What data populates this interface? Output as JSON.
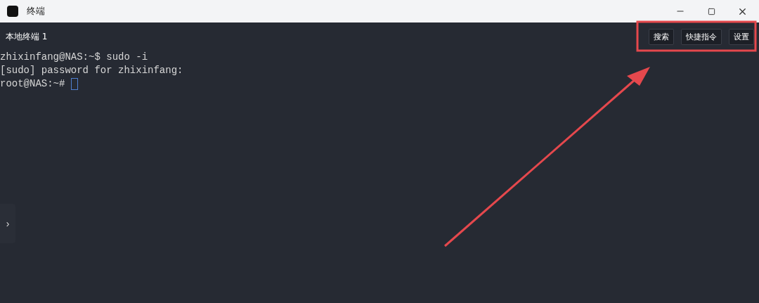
{
  "window": {
    "title": "终端"
  },
  "tab": {
    "label": "本地终端 1"
  },
  "toolbar": {
    "buttons": [
      "搜索",
      "快捷指令",
      "设置"
    ]
  },
  "terminal": {
    "lines": [
      {
        "text": "zhixinfang@NAS:~$ sudo -i",
        "cursor": false
      },
      {
        "text": "[sudo] password for zhixinfang:",
        "cursor": false
      },
      {
        "text": "root@NAS:~# ",
        "cursor": true
      }
    ]
  },
  "sidebar_toggle": {
    "label": "›"
  }
}
